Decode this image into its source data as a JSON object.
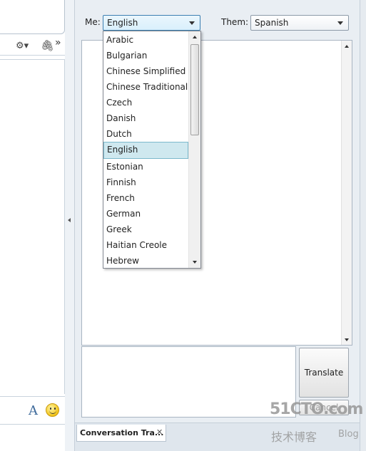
{
  "toolbar": {
    "overflow_label": "»"
  },
  "translator": {
    "me_label": "Me:",
    "me_value": "English",
    "them_label": "Them:",
    "them_value": "Spanish",
    "translate_label": "Translate",
    "cancel_label": "Cancel"
  },
  "dropdown": {
    "options": [
      "Arabic",
      "Bulgarian",
      "Chinese Simplified",
      "Chinese Traditional",
      "Czech",
      "Danish",
      "Dutch",
      "English",
      "Estonian",
      "Finnish",
      "French",
      "German",
      "Greek",
      "Haitian Creole",
      "Hebrew"
    ],
    "selected": "English"
  },
  "tab": {
    "label": "Conversation Tra...",
    "close_label": "✕"
  },
  "format": {
    "font_label": "A"
  },
  "watermark": {
    "brand": "51CTO.com",
    "sub": "技术博客",
    "blog": "Blog"
  }
}
